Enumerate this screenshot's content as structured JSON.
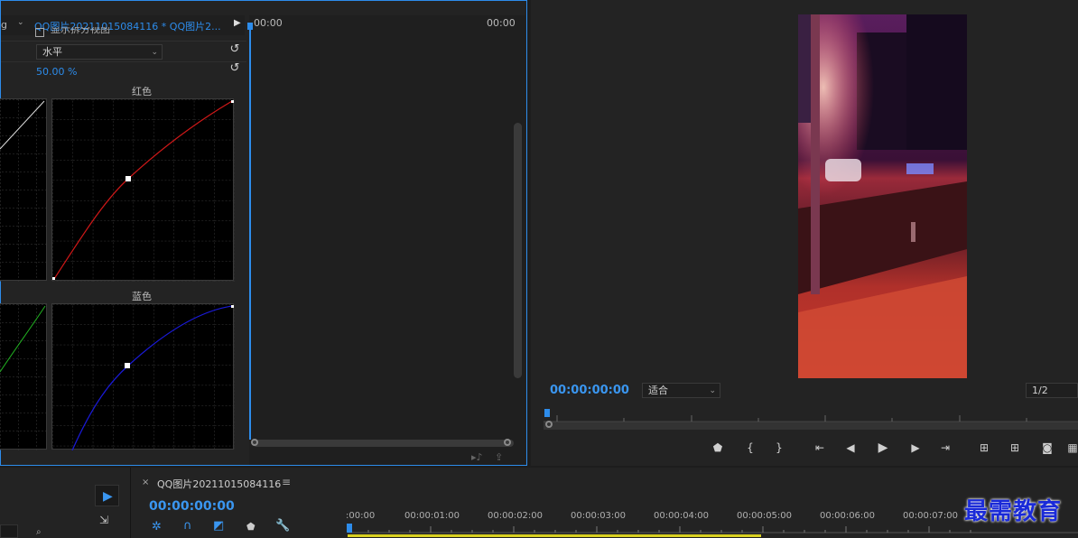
{
  "effect_controls": {
    "tab_left": "g",
    "clip_path": "QQ图片20211015084116 * QQ图片2...",
    "time_start": "00:00",
    "time_end": "00:00",
    "checkbox_label": "显示拆分视图",
    "layout_value": "水平",
    "split_percent": "50.00 %",
    "red_label": "红色",
    "blue_label": "蓝色"
  },
  "program_monitor": {
    "timecode": "00:00:00:00",
    "fit_value": "适合",
    "resolution": "1/2"
  },
  "timeline": {
    "sequence_name": "QQ图片20211015084116",
    "menu_icon": "≡",
    "timecode": "00:00:00:00",
    "ruler": [
      ":00:00",
      "00:00:01:00",
      "00:00:02:00",
      "00:00:03:00",
      "00:00:04:00",
      "00:00:05:00",
      "00:00:06:00",
      "00:00:07:00"
    ]
  },
  "watermark": "最需教育",
  "colors": {
    "accent": "#2d8ceb",
    "red_curve": "#d01818",
    "blue_curve": "#1a1ad8",
    "green_curve": "#22b322"
  }
}
